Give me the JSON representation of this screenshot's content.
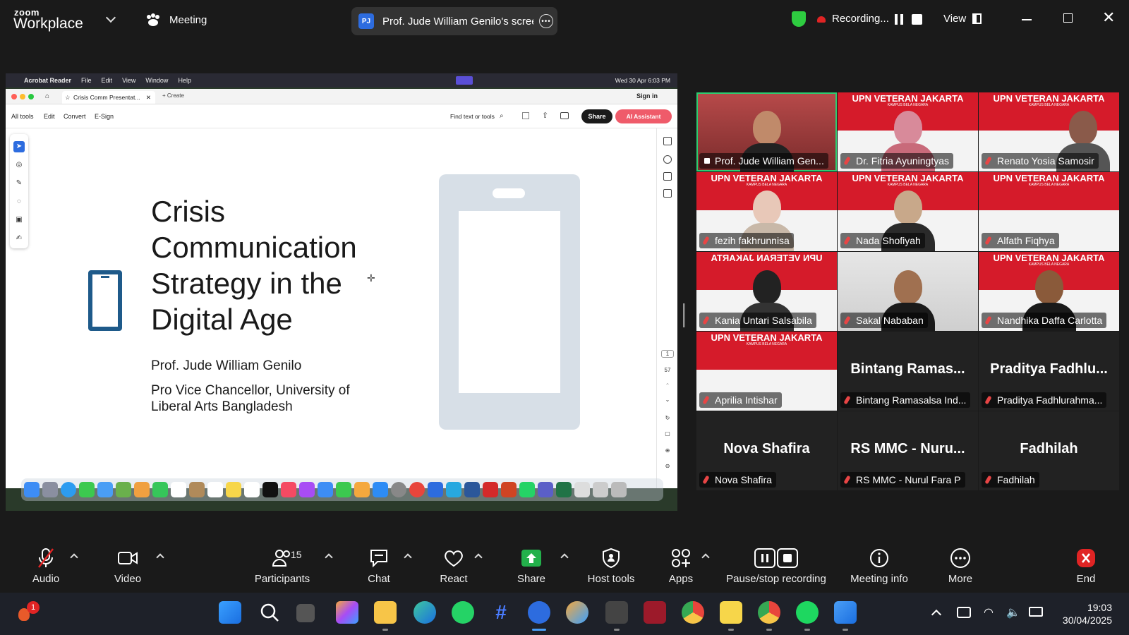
{
  "app": {
    "logo_line1": "zoom",
    "logo_line2": "Workplace",
    "meeting_label": "Meeting",
    "share_badge": "PJ",
    "share_title": "Prof. Jude William Genilo's screen",
    "recording_label": "Recording...",
    "view_label": "View"
  },
  "acrobat": {
    "menubar": [
      "Acrobat Reader",
      "File",
      "Edit",
      "View",
      "Window",
      "Help"
    ],
    "clock": "Wed 30 Apr 6:03 PM",
    "tab_title": "Crisis Comm Presentat...",
    "create_label": "+ Create",
    "signin_label": "Sign in",
    "toolbar": [
      "All tools",
      "Edit",
      "Convert",
      "E-Sign"
    ],
    "find_placeholder": "Find text or tools",
    "share_button": "Share",
    "ai_button": "AI Assistant",
    "page_current": "1",
    "page_total": "57"
  },
  "slide": {
    "title": "Crisis Communication Strategy in the Digital Age",
    "author": "Prof. Jude William Genilo",
    "role": "Pro Vice Chancellor, University of Liberal Arts Bangladesh"
  },
  "gallery": {
    "banner_text": "UPN VETERAN JAKARTA",
    "banner_sub": "KAMPUS BELA NEGARA",
    "participants": [
      {
        "name": "Prof. Jude William Gen...",
        "big": ""
      },
      {
        "name": "Dr. Fitria Ayuningtyas",
        "big": ""
      },
      {
        "name": "Renato Yosia Samosir",
        "big": ""
      },
      {
        "name": "fezih fakhrunnisa",
        "big": ""
      },
      {
        "name": "Nada Shofiyah",
        "big": ""
      },
      {
        "name": "Alfath Fiqhya",
        "big": ""
      },
      {
        "name": "Kania Untari Salsabila",
        "big": ""
      },
      {
        "name": "Sakal Nababan",
        "big": ""
      },
      {
        "name": "Nandhika Daffa Carlotta",
        "big": ""
      },
      {
        "name": "Aprilia Intishar",
        "big": ""
      },
      {
        "name": "Bintang Ramasalsa Ind...",
        "big": "Bintang  Ramas..."
      },
      {
        "name": "Praditya Fadhlurahma...",
        "big": "Praditya  Fadhlu..."
      },
      {
        "name": "Nova Shafira",
        "big": "Nova Shafira"
      },
      {
        "name": "RS MMC - Nurul Fara P",
        "big": "RS MMC - Nuru..."
      },
      {
        "name": "Fadhilah",
        "big": "Fadhilah"
      }
    ]
  },
  "controls": {
    "audio": "Audio",
    "video": "Video",
    "participants": "Participants",
    "participants_count": "15",
    "chat": "Chat",
    "react": "React",
    "share": "Share",
    "host_tools": "Host tools",
    "apps": "Apps",
    "pause_stop": "Pause/stop recording",
    "meeting_info": "Meeting info",
    "more": "More",
    "end": "End"
  },
  "taskbar": {
    "notification_count": "1",
    "time": "19:03",
    "date": "30/04/2025"
  },
  "colors": {
    "zoom_share_green": "#23b04b",
    "active_speaker": "#2ecc71",
    "end_red": "#e02424",
    "banner_red": "#d51b2a",
    "slide_icon_blue": "#1e5a8a"
  }
}
